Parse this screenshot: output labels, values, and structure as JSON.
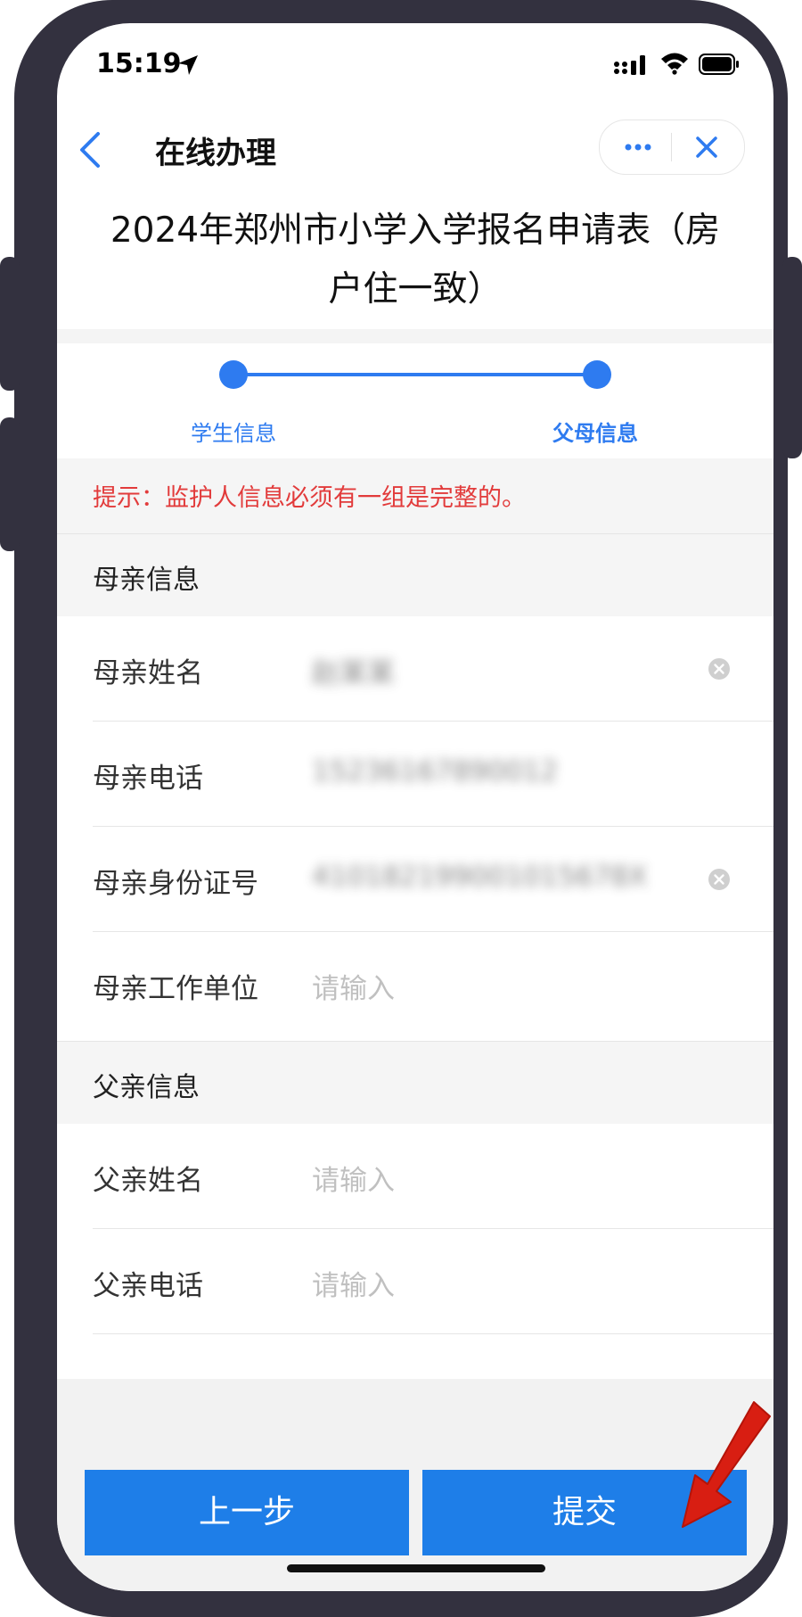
{
  "status": {
    "time": "15:19"
  },
  "nav": {
    "title": "在线办理"
  },
  "form": {
    "title_line1": "2024年郑州市小学入学报名申请表（房",
    "title_line2": "户住一致）"
  },
  "steps": [
    {
      "label": "学生信息"
    },
    {
      "label": "父母信息"
    }
  ],
  "tip": "提示：监护人信息必须有一组是完整的。",
  "mother": {
    "header": "母亲信息",
    "rows": [
      {
        "label": "母亲姓名",
        "value": "赵某某"
      },
      {
        "label": "母亲电话",
        "value": "15236167890012"
      },
      {
        "label": "母亲身份证号",
        "value": "410182199001015678X"
      },
      {
        "label": "母亲工作单位",
        "placeholder": "请输入"
      }
    ]
  },
  "father": {
    "header": "父亲信息",
    "rows": [
      {
        "label": "父亲姓名",
        "placeholder": "请输入"
      },
      {
        "label": "父亲电话",
        "placeholder": "请输入"
      }
    ]
  },
  "buttons": {
    "prev": "上一步",
    "submit": "提交"
  },
  "colors": {
    "accent": "#2e7bf0",
    "button": "#1e7ee8",
    "tip": "#e23b3b",
    "arrow": "#d81e12"
  }
}
